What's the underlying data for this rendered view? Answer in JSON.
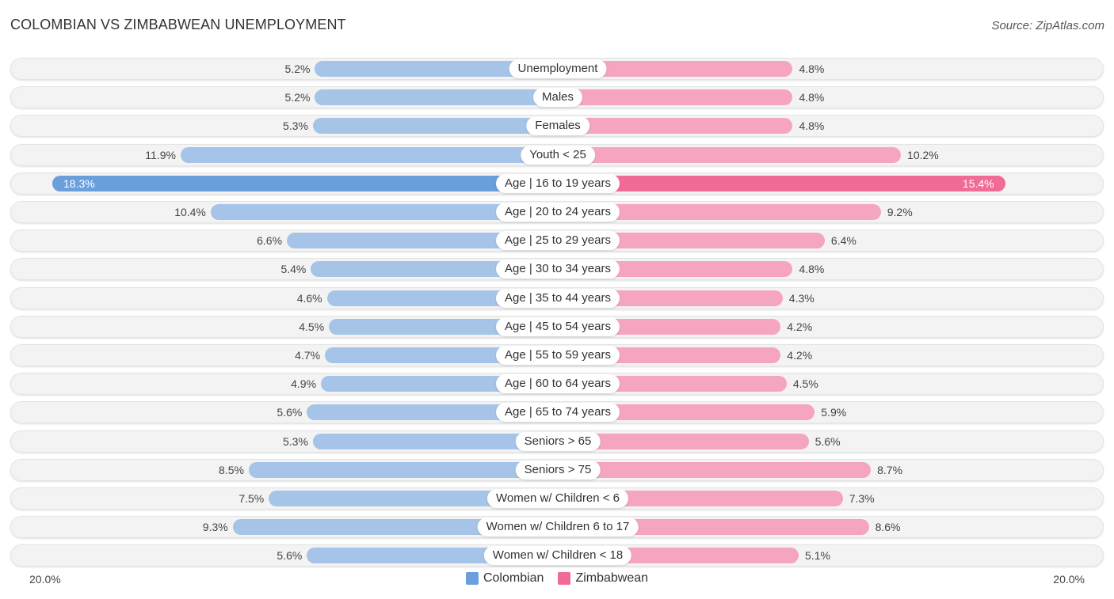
{
  "header": {
    "title": "COLOMBIAN VS ZIMBABWEAN UNEMPLOYMENT",
    "source": "Source: ZipAtlas.com"
  },
  "colors": {
    "colombian": "#a5c4e8",
    "colombian_highlight": "#6a9fdc",
    "zimbabwean": "#f5a5bf",
    "zimbabwean_highlight": "#f06b96",
    "legend_colombian": "#6a9fdc",
    "legend_zimbabwean": "#f06b96"
  },
  "chart_data": {
    "type": "bar",
    "orientation": "horizontal-diverging",
    "title": "COLOMBIAN VS ZIMBABWEAN UNEMPLOYMENT",
    "xlabel": "",
    "ylabel": "",
    "xlim": [
      0,
      20.0
    ],
    "axis_min_label": "20.0%",
    "axis_max_label": "20.0%",
    "legend_position": "bottom-center",
    "grid": false,
    "unit": "%",
    "highlight_category": "Age | 16 to 19 years",
    "categories": [
      "Unemployment",
      "Males",
      "Females",
      "Youth < 25",
      "Age | 16 to 19 years",
      "Age | 20 to 24 years",
      "Age | 25 to 29 years",
      "Age | 30 to 34 years",
      "Age | 35 to 44 years",
      "Age | 45 to 54 years",
      "Age | 55 to 59 years",
      "Age | 60 to 64 years",
      "Age | 65 to 74 years",
      "Seniors > 65",
      "Seniors > 75",
      "Women w/ Children < 6",
      "Women w/ Children 6 to 17",
      "Women w/ Children < 18"
    ],
    "series": [
      {
        "name": "Colombian",
        "side": "left",
        "values": [
          5.2,
          5.2,
          5.3,
          11.9,
          18.3,
          10.4,
          6.6,
          5.4,
          4.6,
          4.5,
          4.7,
          4.9,
          5.6,
          5.3,
          8.5,
          7.5,
          9.3,
          5.6
        ],
        "labels": [
          "5.2%",
          "5.2%",
          "5.3%",
          "11.9%",
          "18.3%",
          "10.4%",
          "6.6%",
          "5.4%",
          "4.6%",
          "4.5%",
          "4.7%",
          "4.9%",
          "5.6%",
          "5.3%",
          "8.5%",
          "7.5%",
          "9.3%",
          "5.6%"
        ]
      },
      {
        "name": "Zimbabwean",
        "side": "right",
        "values": [
          4.8,
          4.8,
          4.8,
          10.2,
          15.4,
          9.2,
          6.4,
          4.8,
          4.3,
          4.2,
          4.2,
          4.5,
          5.9,
          5.6,
          8.7,
          7.3,
          8.6,
          5.1
        ],
        "labels": [
          "4.8%",
          "4.8%",
          "4.8%",
          "10.2%",
          "15.4%",
          "9.2%",
          "6.4%",
          "4.8%",
          "4.3%",
          "4.2%",
          "4.2%",
          "4.5%",
          "5.9%",
          "5.6%",
          "8.7%",
          "7.3%",
          "8.6%",
          "5.1%"
        ]
      }
    ]
  },
  "legend": {
    "items": [
      {
        "label": "Colombian"
      },
      {
        "label": "Zimbabwean"
      }
    ]
  },
  "axis": {
    "left_label": "20.0%",
    "right_label": "20.0%"
  }
}
